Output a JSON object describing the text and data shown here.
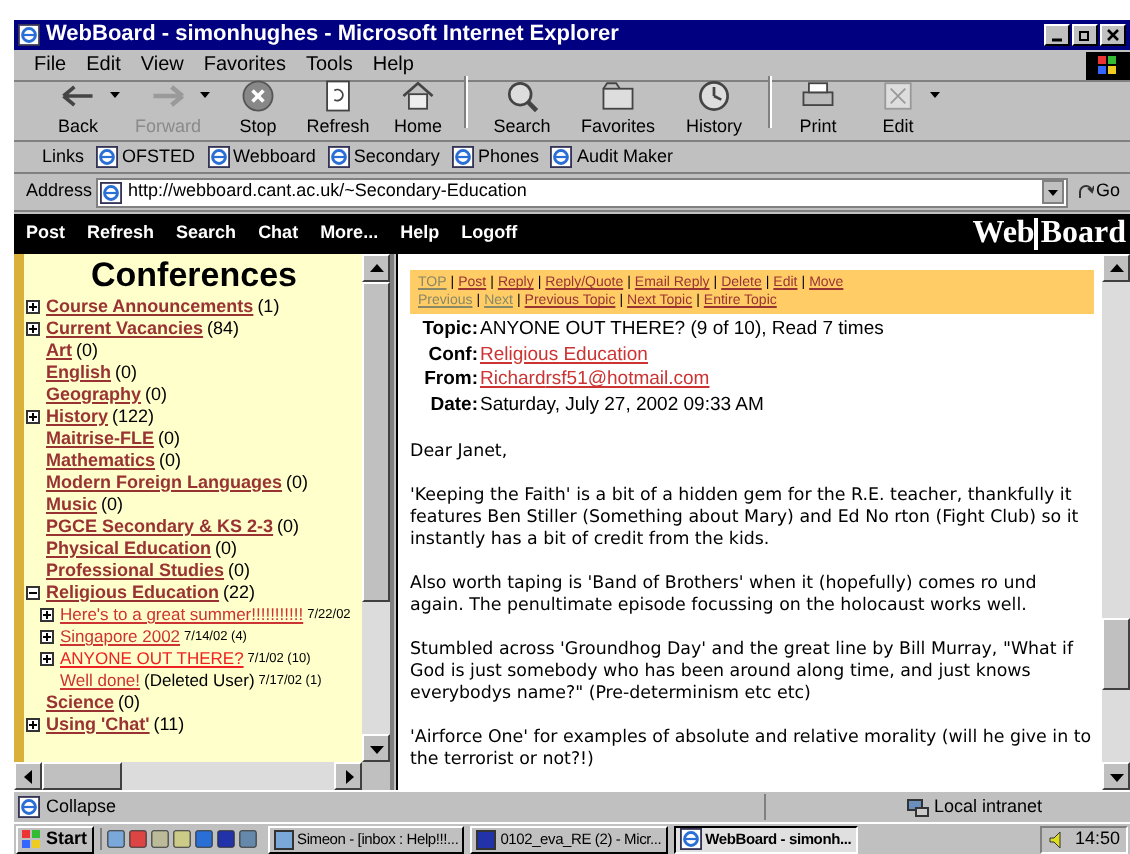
{
  "window": {
    "title": "WebBoard - simonhughes - Microsoft Internet Explorer"
  },
  "menu": [
    "File",
    "Edit",
    "View",
    "Favorites",
    "Tools",
    "Help"
  ],
  "toolbar": [
    {
      "label": "Back",
      "disabled": false,
      "dropdown": true
    },
    {
      "label": "Forward",
      "disabled": true,
      "dropdown": true
    },
    {
      "label": "Stop",
      "disabled": false,
      "dropdown": false
    },
    {
      "label": "Refresh",
      "disabled": false,
      "dropdown": false
    },
    {
      "label": "Home",
      "disabled": false,
      "dropdown": false
    },
    {
      "label": "Search",
      "disabled": false,
      "dropdown": false
    },
    {
      "label": "Favorites",
      "disabled": false,
      "dropdown": false
    },
    {
      "label": "History",
      "disabled": false,
      "dropdown": false
    },
    {
      "label": "Print",
      "disabled": false,
      "dropdown": false
    },
    {
      "label": "Edit",
      "disabled": false,
      "dropdown": true
    }
  ],
  "links": {
    "label": "Links",
    "items": [
      "OFSTED",
      "Webboard",
      "Secondary",
      "Phones",
      "Audit Maker"
    ]
  },
  "address": {
    "label": "Address",
    "value": "http://webboard.cant.ac.uk/~Secondary-Education",
    "go": "Go"
  },
  "nav": {
    "items": [
      "Post",
      "Refresh",
      "Search",
      "Chat",
      "More...",
      "Help",
      "Logoff"
    ],
    "logo": [
      "Web",
      "Board"
    ]
  },
  "conferences": {
    "title": "Conferences",
    "items": [
      {
        "name": "Course Announcements",
        "count": "(1)",
        "expandable": true,
        "expanded": false
      },
      {
        "name": "Current Vacancies",
        "count": "(84)",
        "expandable": true,
        "expanded": false
      },
      {
        "name": "Art",
        "count": "(0)",
        "expandable": false
      },
      {
        "name": "English",
        "count": "(0)",
        "expandable": false
      },
      {
        "name": "Geography",
        "count": "(0)",
        "expandable": false
      },
      {
        "name": "History",
        "count": "(122)",
        "expandable": true,
        "expanded": false
      },
      {
        "name": "Maitrise-FLE",
        "count": "(0)",
        "expandable": false
      },
      {
        "name": "Mathematics",
        "count": "(0)",
        "expandable": false
      },
      {
        "name": "Modern Foreign Languages",
        "count": "(0)",
        "expandable": false
      },
      {
        "name": "Music",
        "count": "(0)",
        "expandable": false
      },
      {
        "name": "PGCE Secondary & KS 2-3",
        "count": "(0)",
        "expandable": false
      },
      {
        "name": "Physical Education",
        "count": "(0)",
        "expandable": false
      },
      {
        "name": "Professional Studies",
        "count": "(0)",
        "expandable": false
      },
      {
        "name": "Religious Education",
        "count": "(22)",
        "expandable": true,
        "expanded": true,
        "children": [
          {
            "title": "Here's to a great summer!!!!!!!!!!!",
            "meta": "7/22/02",
            "expandable": true
          },
          {
            "title": "Singapore 2002",
            "meta": "7/14/02 (4)",
            "expandable": true
          },
          {
            "title": "ANYONE OUT THERE?",
            "meta": "7/1/02 (10)",
            "expandable": true
          },
          {
            "title": "Well done!",
            "author": "(Deleted User)",
            "meta": "7/17/02 (1)",
            "expandable": false
          }
        ]
      },
      {
        "name": "Science",
        "count": "(0)",
        "expandable": false
      },
      {
        "name": "Using 'Chat'",
        "count": "(11)",
        "expandable": true,
        "expanded": false
      }
    ]
  },
  "message": {
    "separator": "|",
    "actions": [
      [
        {
          "label": "TOP",
          "disabled": true
        },
        {
          "label": "Post",
          "disabled": false
        },
        {
          "label": "Reply",
          "disabled": false
        },
        {
          "label": "Reply/Quote",
          "disabled": false
        },
        {
          "label": "Email Reply",
          "disabled": false
        },
        {
          "label": "Delete",
          "disabled": false
        },
        {
          "label": "Edit",
          "disabled": false
        },
        {
          "label": "Move",
          "disabled": false
        }
      ],
      [
        {
          "label": "Previous",
          "disabled": true
        },
        {
          "label": "Next",
          "disabled": true
        },
        {
          "label": "Previous Topic",
          "disabled": false
        },
        {
          "label": "Next Topic",
          "disabled": false
        },
        {
          "label": "Entire Topic",
          "disabled": false
        }
      ]
    ],
    "topic_label": "Topic:",
    "topic": "ANYONE OUT THERE? (9 of 10), Read 7 times",
    "conf_label": "Conf:",
    "conf": "Religious Education",
    "from_label": "From:",
    "from_name": "Richard",
    "from_email": "rsf51@hotmail.com",
    "date_label": "Date:",
    "date": "Saturday, July 27, 2002 09:33 AM",
    "body": [
      "Dear Janet,",
      "'Keeping the Faith' is a bit of a hidden gem for the R.E. teacher, thankfully it features Ben Stiller (Something about Mary) and Ed No rton (Fight Club) so it instantly has a bit of credit from the kids.",
      "Also worth taping is 'Band of Brothers' when it (hopefully) comes ro und again. The penultimate episode focussing on the holocaust works well.",
      "Stumbled across 'Groundhog Day' and the great line by Bill Murray,  \"What if God is just somebody who has been around along time, and just knows everybodys name?\" (Pre-determinism etc etc)",
      "'Airforce One' for examples of absolute and relative morality (will he  give in to the terrorist or not?!)"
    ]
  },
  "status_bar": {
    "text": "Collapse",
    "zone": "Local intranet"
  },
  "taskbar": {
    "start": "Start",
    "tasks": [
      {
        "label": "Simeon - [inbox : Help!!!...",
        "selected": false
      },
      {
        "label": "0102_eva_RE (2) - Micr...",
        "selected": false
      },
      {
        "label": "WebBoard - simonh...",
        "selected": true
      }
    ],
    "clock": "14:50"
  }
}
